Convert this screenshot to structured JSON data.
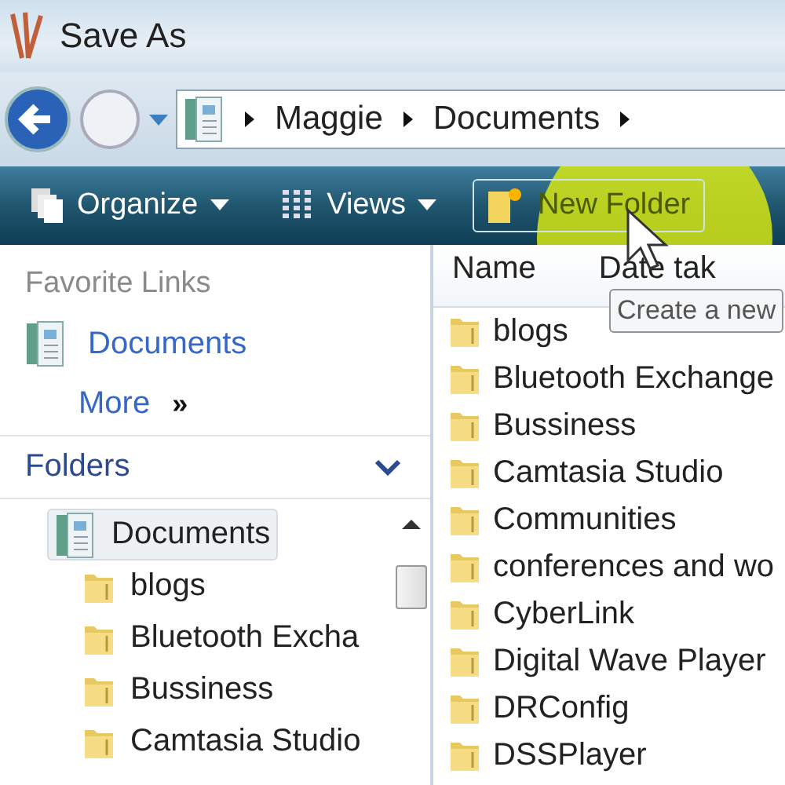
{
  "window": {
    "title": "Save As"
  },
  "address": {
    "crumbs": [
      "Maggie",
      "Documents"
    ]
  },
  "toolbar": {
    "buttons": [
      {
        "label": "Organize",
        "kind": "organize",
        "hovered": false
      },
      {
        "label": "Views",
        "kind": "views",
        "hovered": false
      },
      {
        "label": "New Folder",
        "kind": "new-folder",
        "hovered": true
      }
    ]
  },
  "favorite_links": {
    "heading": "Favorite Links",
    "items": [
      {
        "label": "Documents",
        "kind": "library"
      },
      {
        "label": "More",
        "kind": "more",
        "glyph": "»"
      }
    ]
  },
  "folders": {
    "heading": "Folders",
    "expanded": true,
    "tree": [
      {
        "label": "Documents",
        "selected": true,
        "children": [
          {
            "label": "blogs",
            "selected": false
          },
          {
            "label": "Bluetooth Excha",
            "selected": false
          },
          {
            "label": "Bussiness",
            "selected": false
          },
          {
            "label": "Camtasia Studio",
            "selected": false
          }
        ]
      }
    ]
  },
  "file_list": {
    "columns": [
      "Name",
      "Date tak"
    ],
    "rows": [
      "blogs",
      "Bluetooth Exchange",
      "Bussiness",
      "Camtasia Studio",
      "Communities",
      "conferences and wo",
      "CyberLink",
      "Digital Wave Player",
      "DRConfig",
      "DSSPlayer"
    ]
  },
  "tooltip": "Create a new"
}
